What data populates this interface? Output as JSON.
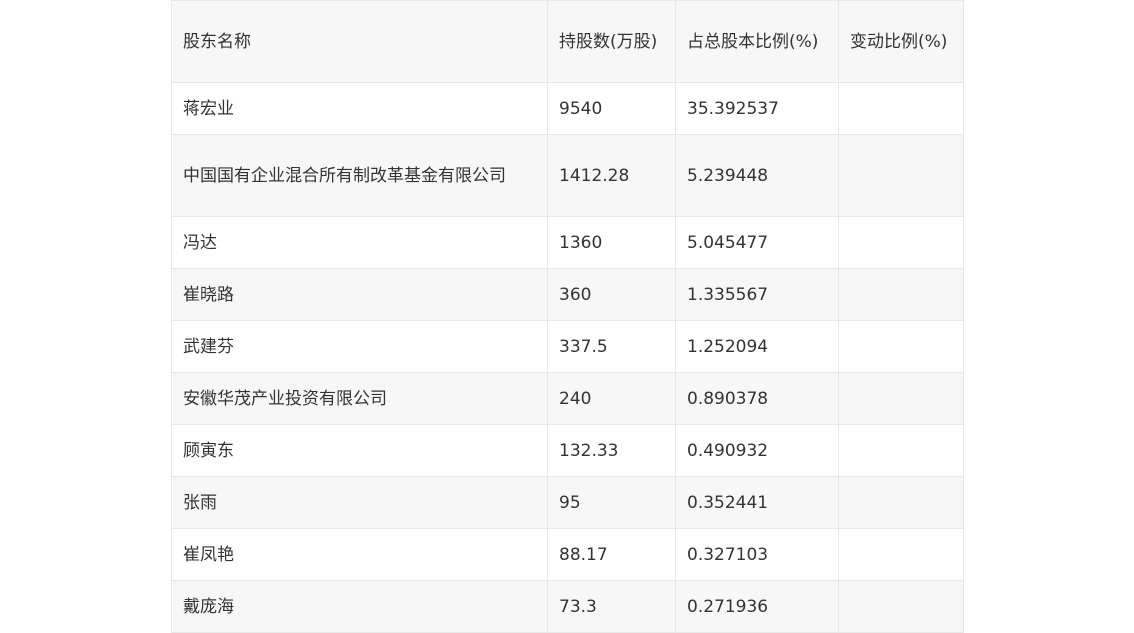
{
  "table": {
    "headers": [
      "股东名称",
      "持股数(万股)",
      "占总股本比例(%)",
      "变动比例(%)"
    ],
    "rows": [
      [
        "蒋宏业",
        "9540",
        "35.392537",
        ""
      ],
      [
        "中国国有企业混合所有制改革基金有限公司",
        "1412.28",
        "5.239448",
        ""
      ],
      [
        "冯达",
        "1360",
        "5.045477",
        ""
      ],
      [
        "崔晓路",
        "360",
        "1.335567",
        ""
      ],
      [
        "武建芬",
        "337.5",
        "1.252094",
        ""
      ],
      [
        "安徽华茂产业投资有限公司",
        "240",
        "0.890378",
        ""
      ],
      [
        "顾寅东",
        "132.33",
        "0.490932",
        ""
      ],
      [
        "张雨",
        "95",
        "0.352441",
        ""
      ],
      [
        "崔凤艳",
        "88.17",
        "0.327103",
        ""
      ],
      [
        "戴庞海",
        "73.3",
        "0.271936",
        ""
      ]
    ]
  }
}
